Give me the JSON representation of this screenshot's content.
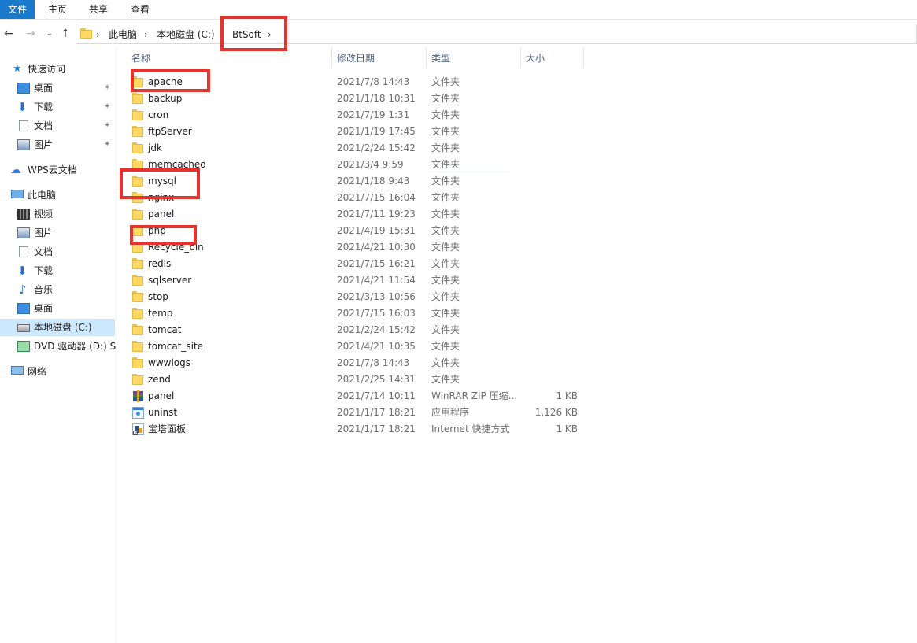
{
  "ribbon": {
    "tabs": [
      "文件",
      "主页",
      "共享",
      "查看"
    ]
  },
  "address": {
    "crumbs": [
      "此电脑",
      "本地磁盘 (C:)",
      "BtSoft"
    ]
  },
  "sidebar": {
    "items": [
      {
        "label": "快速访问",
        "icon": "star-icon",
        "pinned": false
      },
      {
        "label": "桌面",
        "icon": "desktop-icon",
        "pinned": true
      },
      {
        "label": "下载",
        "icon": "download-icon",
        "pinned": true
      },
      {
        "label": "文档",
        "icon": "document-icon",
        "pinned": true
      },
      {
        "label": "图片",
        "icon": "picture-icon",
        "pinned": true
      },
      {
        "label": "WPS云文档",
        "icon": "cloud-icon",
        "pinned": false
      },
      {
        "label": "此电脑",
        "icon": "computer-icon",
        "pinned": false
      },
      {
        "label": "视频",
        "icon": "video-icon",
        "pinned": false
      },
      {
        "label": "图片",
        "icon": "picture-icon",
        "pinned": false
      },
      {
        "label": "文档",
        "icon": "document-icon",
        "pinned": false
      },
      {
        "label": "下载",
        "icon": "download-icon",
        "pinned": false
      },
      {
        "label": "音乐",
        "icon": "music-icon",
        "pinned": false
      },
      {
        "label": "桌面",
        "icon": "desktop-icon",
        "pinned": false
      },
      {
        "label": "本地磁盘 (C:)",
        "icon": "drive-icon",
        "pinned": false
      },
      {
        "label": "DVD 驱动器 (D:) SS",
        "icon": "dvd-icon",
        "pinned": false
      },
      {
        "label": "网络",
        "icon": "network-icon",
        "pinned": false
      }
    ]
  },
  "columns": {
    "name": "名称",
    "date": "修改日期",
    "type": "类型",
    "size": "大小"
  },
  "files": [
    {
      "name": "apache",
      "date": "2021/7/8 14:43",
      "type": "文件夹",
      "size": "",
      "icon": "folder-icon"
    },
    {
      "name": "backup",
      "date": "2021/1/18 10:31",
      "type": "文件夹",
      "size": "",
      "icon": "folder-icon"
    },
    {
      "name": "cron",
      "date": "2021/7/19 1:31",
      "type": "文件夹",
      "size": "",
      "icon": "folder-icon"
    },
    {
      "name": "ftpServer",
      "date": "2021/1/19 17:45",
      "type": "文件夹",
      "size": "",
      "icon": "folder-icon"
    },
    {
      "name": "jdk",
      "date": "2021/2/24 15:42",
      "type": "文件夹",
      "size": "",
      "icon": "folder-icon"
    },
    {
      "name": "memcached",
      "date": "2021/3/4 9:59",
      "type": "文件夹",
      "size": "",
      "icon": "folder-icon"
    },
    {
      "name": "mysql",
      "date": "2021/1/18 9:43",
      "type": "文件夹",
      "size": "",
      "icon": "folder-icon"
    },
    {
      "name": "nginx",
      "date": "2021/7/15 16:04",
      "type": "文件夹",
      "size": "",
      "icon": "folder-icon"
    },
    {
      "name": "panel",
      "date": "2021/7/11 19:23",
      "type": "文件夹",
      "size": "",
      "icon": "folder-icon"
    },
    {
      "name": "php",
      "date": "2021/4/19 15:31",
      "type": "文件夹",
      "size": "",
      "icon": "folder-icon"
    },
    {
      "name": "Recycle_bin",
      "date": "2021/4/21 10:30",
      "type": "文件夹",
      "size": "",
      "icon": "folder-icon"
    },
    {
      "name": "redis",
      "date": "2021/7/15 16:21",
      "type": "文件夹",
      "size": "",
      "icon": "folder-icon"
    },
    {
      "name": "sqlserver",
      "date": "2021/4/21 11:54",
      "type": "文件夹",
      "size": "",
      "icon": "folder-icon"
    },
    {
      "name": "stop",
      "date": "2021/3/13 10:56",
      "type": "文件夹",
      "size": "",
      "icon": "folder-icon"
    },
    {
      "name": "temp",
      "date": "2021/7/15 16:03",
      "type": "文件夹",
      "size": "",
      "icon": "folder-icon"
    },
    {
      "name": "tomcat",
      "date": "2021/2/24 15:42",
      "type": "文件夹",
      "size": "",
      "icon": "folder-icon"
    },
    {
      "name": "tomcat_site",
      "date": "2021/4/21 10:35",
      "type": "文件夹",
      "size": "",
      "icon": "folder-icon"
    },
    {
      "name": "wwwlogs",
      "date": "2021/7/8 14:43",
      "type": "文件夹",
      "size": "",
      "icon": "folder-icon"
    },
    {
      "name": "zend",
      "date": "2021/2/25 14:31",
      "type": "文件夹",
      "size": "",
      "icon": "folder-icon"
    },
    {
      "name": "panel",
      "date": "2021/7/14 10:11",
      "type": "WinRAR ZIP 压缩...",
      "size": "1 KB",
      "icon": "winrar-zip-icon"
    },
    {
      "name": "uninst",
      "date": "2021/1/17 18:21",
      "type": "应用程序",
      "size": "1,126 KB",
      "icon": "application-icon"
    },
    {
      "name": "宝塔面板",
      "date": "2021/1/17 18:21",
      "type": "Internet 快捷方式",
      "size": "1 KB",
      "icon": "internet-shortcut-icon"
    }
  ],
  "colors": {
    "ribbon_active": "#1979ca",
    "highlight": "#e8322e",
    "selected": "#cce8ff"
  }
}
